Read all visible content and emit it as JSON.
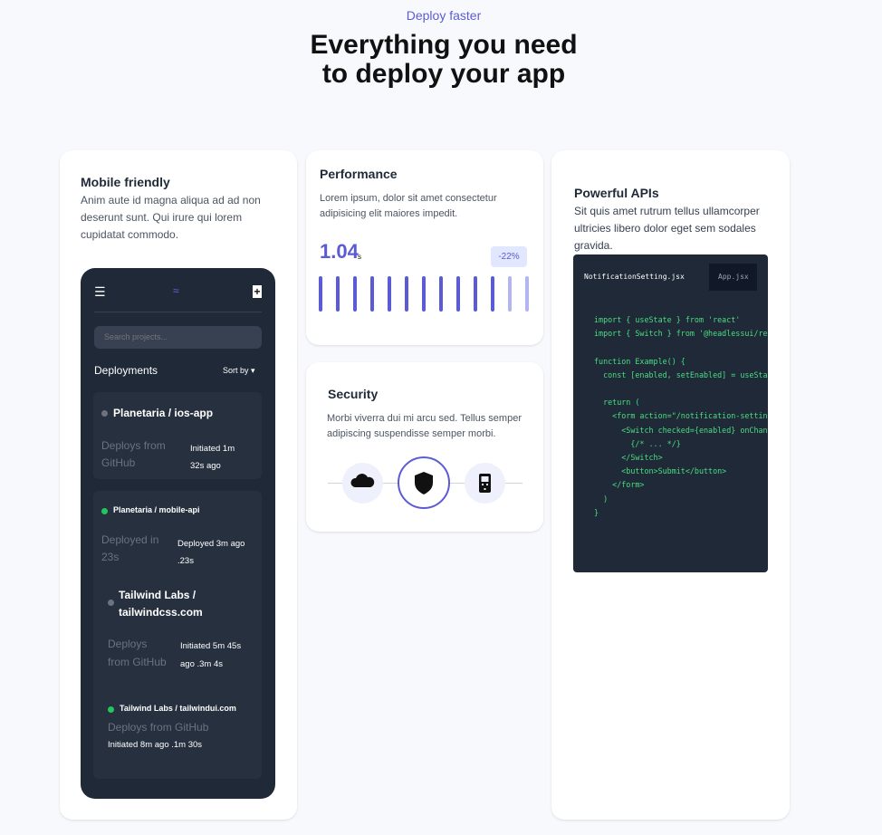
{
  "header": {
    "eyebrow": "Deploy faster",
    "headline_line1": "Everything you need",
    "headline_line2": "to deploy your app"
  },
  "mobile_card": {
    "title": "Mobile friendly",
    "description": "Anim aute id magna aliqua ad ad non deserunt sunt. Qui irure qui lorem cupidatat commodo.",
    "phone": {
      "menu_icon": "☰",
      "logo_icon": "≈",
      "plus_icon": "+",
      "search_placeholder": "Search projects...",
      "deployments_label": "Deployments",
      "sort_label": "Sort by ▾",
      "deployments": [
        {
          "name": "Planetaria / ios-app",
          "source_line1": "Deploys from",
          "source_line2": "GitHub",
          "meta_line1": "Initiated 1m",
          "meta_line2": "32s ago",
          "status": "gray"
        },
        {
          "name": "Planetaria / mobile-api",
          "source_line1": "Deployed in",
          "source_line2": "23s",
          "meta_line1": "Deployed 3m ago",
          "meta_line2": ".23s",
          "status": "green"
        },
        {
          "name_line1": "Tailwind Labs /",
          "name_line2": "tailwindcss.com",
          "source_line1": "Deploys",
          "source_line2": "from GitHub",
          "meta_line1": "Initiated 5m 45s",
          "meta_line2": "ago .3m 4s",
          "status": "gray"
        },
        {
          "name": "Tailwind Labs / tailwindui.com",
          "source": "Deploys from GitHub",
          "meta": "Initiated 8m ago .1m 30s",
          "status": "green"
        }
      ],
      "status_colors": {
        "green": "#22c55e",
        "gray": "#6b7280"
      }
    }
  },
  "performance_card": {
    "title": "Performance",
    "description": "Lorem ipsum, dolor sit amet consectetur adipisicing elit maiores impedit.",
    "value": "1.04",
    "unit": "s",
    "badge": "-22%",
    "bars_solid": 11,
    "bars_faded": 3,
    "bar_color": "#5b5bd6",
    "bar_faded_color": "#b4b4f0"
  },
  "security_card": {
    "title": "Security",
    "description": "Morbi viverra dui mi arcu sed. Tellus semper adipiscing suspendisse semper morbi.",
    "icons": [
      "cloud-icon",
      "shield-icon",
      "phone-icon"
    ]
  },
  "api_card": {
    "title": "Powerful APIs",
    "description": "Sit quis amet rutrum tellus ullamcorper ultricies libero dolor eget sem sodales gravida.",
    "tabs": [
      "NotificationSetting.jsx",
      "App.jsx"
    ],
    "code": [
      "import { useState } from 'react'",
      "import { Switch } from '@headlessui/react'",
      "",
      "function Example() {",
      "  const [enabled, setEnabled] = useState(true)",
      "",
      "  return (",
      "    <form action=\"/notification-settings\">",
      "      <Switch checked={enabled} onChange={setEnabled}>",
      "        {/* ... */}",
      "      </Switch>",
      "      <button>Submit</button>",
      "    </form>",
      "  )",
      "}"
    ]
  }
}
